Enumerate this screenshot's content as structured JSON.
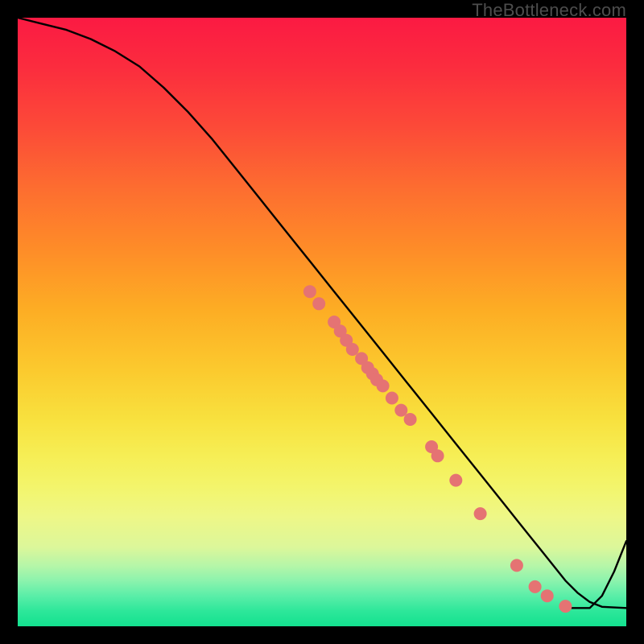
{
  "watermark": "TheBottleneck.com",
  "colors": {
    "curve": "#000000",
    "marker_fill": "#e57373",
    "marker_stroke": "#c05555"
  },
  "chart_data": {
    "type": "line",
    "title": "",
    "xlabel": "",
    "ylabel": "",
    "xlim": [
      0,
      100
    ],
    "ylim": [
      0,
      100
    ],
    "grid": false,
    "legend": false,
    "series": [
      {
        "name": "curve",
        "x": [
          0,
          4,
          8,
          12,
          16,
          20,
          24,
          28,
          32,
          36,
          40,
          44,
          48,
          52,
          56,
          60,
          64,
          68,
          72,
          76,
          80,
          82,
          84,
          86,
          88,
          90,
          92,
          94,
          96,
          98,
          100
        ],
        "y": [
          100,
          99,
          98,
          96.5,
          94.5,
          92,
          88.5,
          84.5,
          80,
          75,
          70,
          65,
          60,
          55,
          50,
          45,
          40,
          35,
          30,
          25,
          20,
          17.5,
          15,
          12.5,
          10,
          7.5,
          5.5,
          4,
          3.2,
          3.1,
          3
        ]
      },
      {
        "name": "tail-rise",
        "x": [
          90,
          92,
          94,
          96,
          98,
          100
        ],
        "y": [
          3,
          3,
          3,
          5,
          9,
          14
        ]
      }
    ],
    "markers": [
      {
        "x": 48,
        "y": 55
      },
      {
        "x": 49.5,
        "y": 53
      },
      {
        "x": 52,
        "y": 50
      },
      {
        "x": 53,
        "y": 48.5
      },
      {
        "x": 54,
        "y": 47
      },
      {
        "x": 55,
        "y": 45.5
      },
      {
        "x": 56.5,
        "y": 44
      },
      {
        "x": 57.5,
        "y": 42.5
      },
      {
        "x": 58.3,
        "y": 41.5
      },
      {
        "x": 59,
        "y": 40.5
      },
      {
        "x": 60,
        "y": 39.5
      },
      {
        "x": 61.5,
        "y": 37.5
      },
      {
        "x": 63,
        "y": 35.5
      },
      {
        "x": 64.5,
        "y": 34
      },
      {
        "x": 68,
        "y": 29.5
      },
      {
        "x": 69,
        "y": 28
      },
      {
        "x": 72,
        "y": 24
      },
      {
        "x": 76,
        "y": 18.5
      },
      {
        "x": 82,
        "y": 10
      },
      {
        "x": 85,
        "y": 6.5
      },
      {
        "x": 87,
        "y": 5
      },
      {
        "x": 90,
        "y": 3.3
      }
    ]
  }
}
